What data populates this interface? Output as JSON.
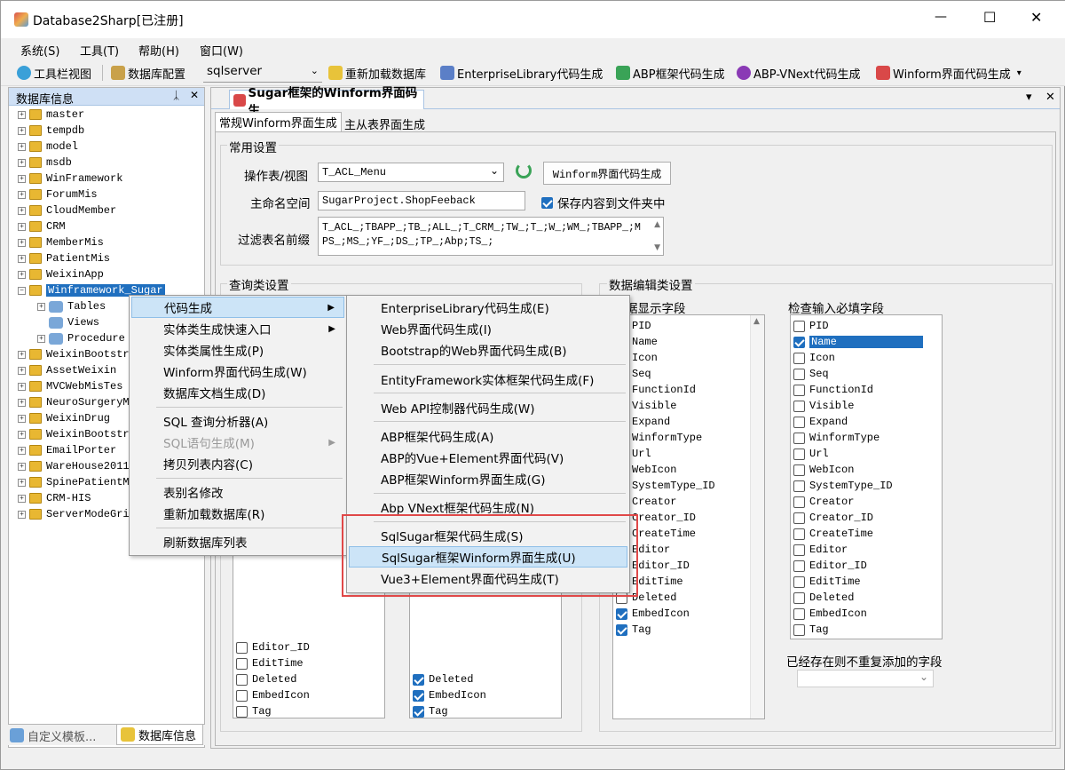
{
  "window": {
    "title": "Database2Sharp[已注册]",
    "minimize": "—",
    "maximize": "☐",
    "close": "✕"
  },
  "menubar": [
    "系统(S)",
    "工具(T)",
    "帮助(H)",
    "窗口(W)"
  ],
  "toolbar": {
    "toolbar_view": "工具栏视图",
    "db_config": "数据库配置",
    "db_type": "sqlserver",
    "reload_db": "重新加载数据库",
    "entlib_gen": "EnterpriseLibrary代码生成",
    "abp_gen": "ABP框架代码生成",
    "abp_vnext_gen": "ABP-VNext代码生成",
    "winform_gen": "Winform界面代码生成"
  },
  "db_panel": {
    "title": "数据库信息",
    "pin": "ᛣ",
    "close": "✕",
    "items": [
      "master",
      "tempdb",
      "model",
      "msdb",
      "WinFramework",
      "ForumMis",
      "CloudMember",
      "CRM",
      "MemberMis",
      "PatientMis",
      "WeixinApp",
      "Winframework_Sugar",
      "Tables",
      "Views",
      "Procedure",
      "WeixinBootstr",
      "AssetWeixin",
      "MVCWebMisTes",
      "NeuroSurgeryM",
      "WeixinDrug",
      "WeixinBootstr",
      "EmailPorter",
      "WareHouse2011",
      "SpinePatientM",
      "CRM-HIS",
      "ServerModeGri"
    ],
    "bottom_tabs": [
      "自定义模板...",
      "数据库信息"
    ]
  },
  "doc_tab": {
    "title": "Sugar框架的Winform界面码生",
    "dropdown": "▾",
    "close": "✕"
  },
  "sub_tabs": [
    "常规Winform界面生成",
    "主从表界面生成"
  ],
  "common": {
    "group_title": "常用设置",
    "table_label": "操作表/视图",
    "table_value": "T_ACL_Menu",
    "gen_button": "Winform界面代码生成",
    "ns_label": "主命名空间",
    "ns_value": "SugarProject.ShopFeeback",
    "save_checkbox": "保存内容到文件夹中",
    "save_checked": true,
    "filter_label": "过滤表名前缀",
    "filter_value": "T_ACL_;TBAPP_;TB_;ALL_;T_CRM_;TW_;T_;W_;WM_;TBAPP_;MPS_;MS_;YF_;DS_;TP_;Abp;TS_;"
  },
  "query_group": {
    "title": "查询类设置"
  },
  "edit_group": {
    "title": "数据编辑类设置",
    "display_label": "据显示字段",
    "required_label": "检查输入必填字段"
  },
  "fields": [
    "PID",
    "Name",
    "Icon",
    "Seq",
    "FunctionId",
    "Visible",
    "Expand",
    "WinformType",
    "Url",
    "WebIcon",
    "SystemType_ID",
    "Creator",
    "Creator_ID",
    "CreateTime",
    "Editor",
    "Editor_ID",
    "EditTime",
    "Deleted",
    "EmbedIcon",
    "Tag"
  ],
  "query_list_a": {
    "visible": [
      "Editor_ID",
      "EditTime",
      "Deleted",
      "EmbedIcon",
      "Tag"
    ],
    "checked": [
      false,
      false,
      false,
      false,
      false
    ]
  },
  "query_list_b": {
    "visible": [
      "Deleted",
      "EmbedIcon",
      "Tag"
    ],
    "checked": [
      true,
      true,
      true
    ]
  },
  "display_list": {
    "checked": [
      false,
      false,
      false,
      false,
      false,
      false,
      false,
      false,
      false,
      false,
      false,
      false,
      false,
      false,
      false,
      false,
      false,
      false,
      true,
      true
    ]
  },
  "required_list": {
    "checked": [
      false,
      true,
      false,
      false,
      false,
      false,
      false,
      false,
      false,
      false,
      false,
      false,
      false,
      false,
      false,
      false,
      false,
      false,
      false,
      false
    ]
  },
  "no_dup_label": "已经存在则不重复添加的字段",
  "context_menu": {
    "items": [
      "代码生成",
      "实体类生成快速入口",
      "实体类属性生成(P)",
      "Winform界面代码生成(W)",
      "数据库文档生成(D)",
      "SQL 查询分析器(A)",
      "SQL语句生成(M)",
      "拷贝列表内容(C)",
      "表别名修改",
      "重新加载数据库(R)",
      "刷新数据库列表"
    ]
  },
  "submenu": {
    "items": [
      "EnterpriseLibrary代码生成(E)",
      "Web界面代码生成(I)",
      "Bootstrap的Web界面代码生成(B)",
      "EntityFramework实体框架代码生成(F)",
      "Web API控制器代码生成(W)",
      "ABP框架代码生成(A)",
      "ABP的Vue+Element界面代码(V)",
      "ABP框架Winform界面生成(G)",
      "Abp VNext框架代码生成(N)",
      "SqlSugar框架代码生成(S)",
      "SqlSugar框架Winform界面生成(U)",
      "Vue3+Element界面代码生成(T)"
    ]
  },
  "colors": {
    "accent": "#1f6fbf",
    "highlight": "#cce4f7",
    "red_box": "#e04848",
    "panel_header": "#cfe0f5"
  }
}
